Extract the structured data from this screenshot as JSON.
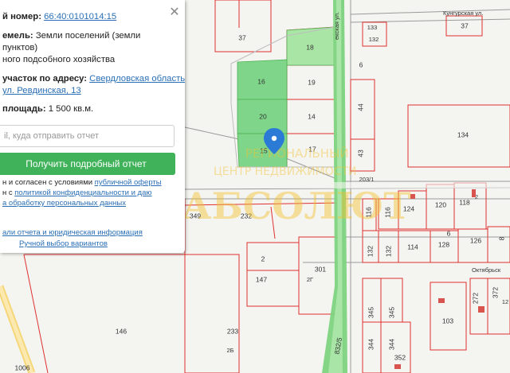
{
  "panel": {
    "cadastral_label": "й номер:",
    "cadastral_value": "66:40:0101014:15",
    "land_category_label": "емель:",
    "land_category_value_1": "Земли поселений (земли",
    "land_category_value_2": "пунктов)",
    "land_category_value_3": "ного подсобного хозяйства",
    "address_label": "участок по адресу:",
    "address_value_1": "Свердловская область,",
    "address_value_2": "ул. Ревдинская, 13",
    "area_label": "площадь:",
    "area_value": "1 500 кв.м.",
    "email_placeholder": "il, куда отправить отчет",
    "get_report_button": "Получить подробный отчет",
    "agree_line_1_a": "н и согласен с условиями ",
    "agree_line_1_link": "публичной оферты",
    "agree_line_2_a": "н с ",
    "agree_line_2_link": "политикой конфиденциальности и даю",
    "agree_line_3_link": "а обработку персональных данных",
    "report_types_link": "али отчета и юридическая информация",
    "manual_select_link": "Ручной выбор вариантов",
    "close_icon": "✕"
  },
  "map": {
    "streets": {
      "kungurskaya": "Кунгурская ул.",
      "oktyabrskaya": "Октябрьск",
      "vertical": "екская ул."
    },
    "parcels": [
      "37",
      "18",
      "6",
      "16",
      "19",
      "44",
      "20",
      "14",
      "15",
      "17",
      "43",
      "134",
      "133",
      "132",
      "37",
      "203/1",
      "116",
      "124",
      "120",
      "118",
      "2",
      "349",
      "232",
      "6",
      "132",
      "114",
      "128",
      "126",
      "8",
      "2",
      "147",
      "2Г",
      "301",
      "345",
      "345",
      "103",
      "146",
      "233",
      "2Б",
      "344",
      "344",
      "352",
      "832/5",
      "1006",
      "272",
      "372",
      "12"
    ],
    "watermark_title": "АБСОЛЮТ",
    "watermark_subtitle_1": "РЕГИОНАЛЬНЫЙ",
    "watermark_subtitle_2": "ЦЕНТР НЕДВИЖИМОСТИ",
    "marker_icon": "map-pin-icon",
    "colors": {
      "selected_parcel": "#7fd68a",
      "light_parcel": "#a9e6a6",
      "road_green": "#7ed37f",
      "parcel_border": "#e03030",
      "marker": "#2a7ad6"
    }
  }
}
